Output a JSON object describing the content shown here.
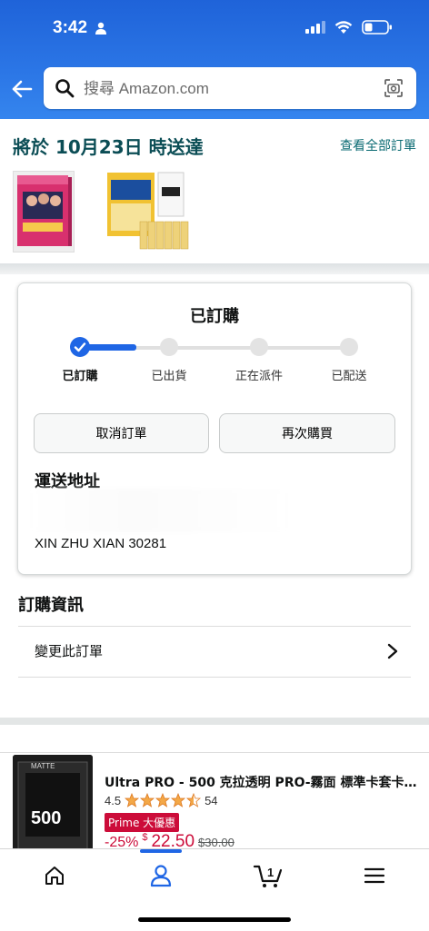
{
  "status_bar": {
    "time": "3:42"
  },
  "search": {
    "placeholder": "搜尋 Amazon.com"
  },
  "delivery": {
    "title": "將於 10月23日 時送達",
    "view_all": "查看全部訂單"
  },
  "order_status": {
    "title": "已訂購",
    "progress_current_step": 1,
    "steps": [
      "已訂購",
      "已出貨",
      "正在派件",
      "已配送"
    ]
  },
  "actions": {
    "cancel": "取消訂單",
    "buy_again": "再次購買"
  },
  "shipping": {
    "title": "運送地址",
    "line": "XIN ZHU XIAN 30281"
  },
  "order_info": {
    "title": "訂購資訊",
    "change_order": "變更此訂單"
  },
  "product": {
    "image_text": "500",
    "image_brand": "MATTE",
    "title": "Ultra PRO - 500 克拉透明 PRO-霧面 標準卡套卡套,...",
    "rating": "4.5",
    "rating_stars": 4.5,
    "review_count": "54",
    "badge": "Prime 大優惠",
    "discount": "-25%",
    "currency": "$",
    "price": "22.50",
    "list_price": "$30.00"
  },
  "cart": {
    "count": "1"
  },
  "colors": {
    "accent": "#1f66e5",
    "header": "#2b76e6",
    "teal_text": "#0b4d55",
    "deal_red": "#cc0c39"
  }
}
